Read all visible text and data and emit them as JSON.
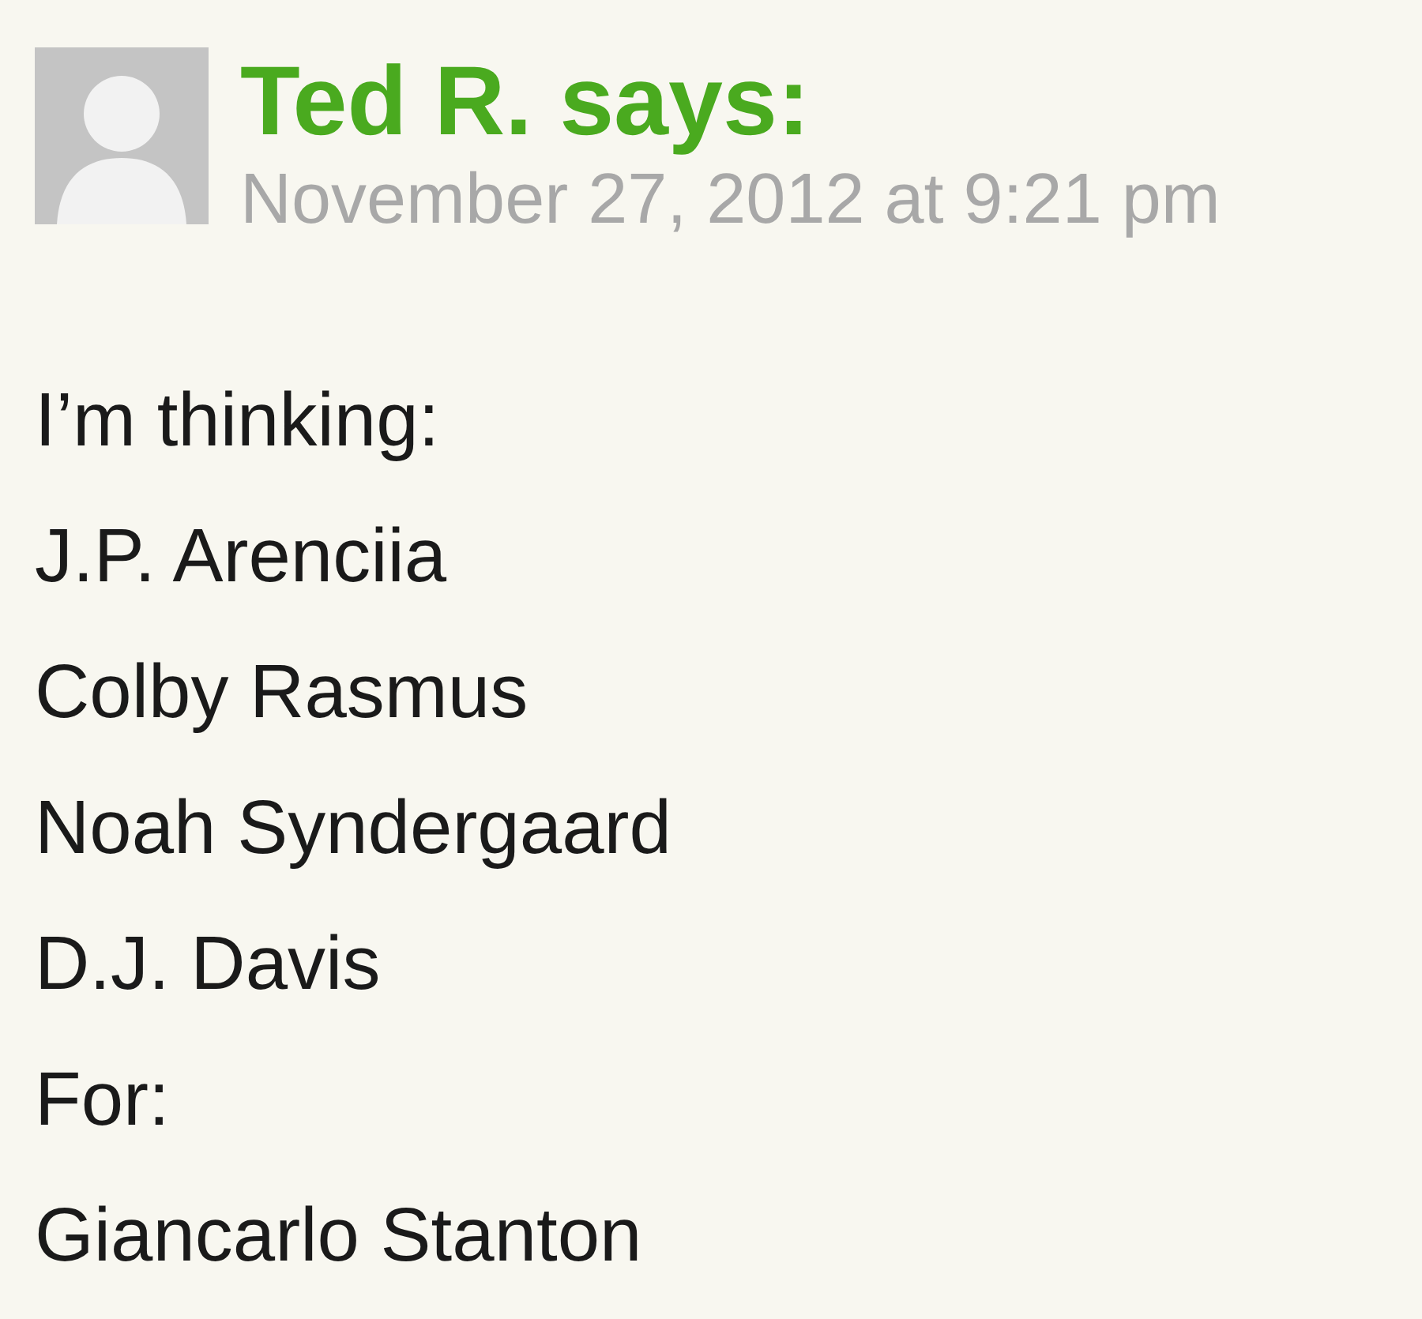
{
  "comment": {
    "author_line": "Ted R. says:",
    "date": "November 27, 2012 at 9:21 pm",
    "lines": [
      "I’m thinking:",
      "J.P. Arenciia",
      "Colby Rasmus",
      "Noah Syndergaard",
      "D.J. Davis",
      "For:",
      "Giancarlo Stanton"
    ]
  }
}
